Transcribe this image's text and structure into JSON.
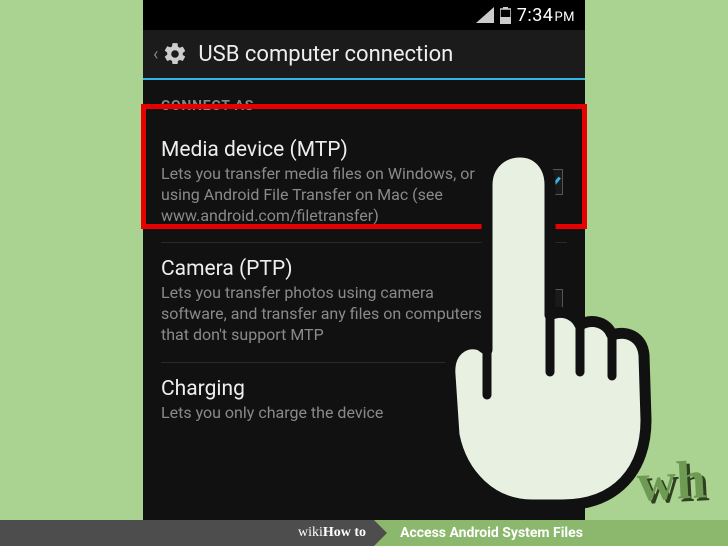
{
  "status": {
    "time": "7:34",
    "ampm": "PM"
  },
  "header": {
    "title": "USB computer connection"
  },
  "section_label": "CONNECT AS",
  "items": [
    {
      "title": "Media device (MTP)",
      "subtitle": "Lets you transfer media files on Windows, or using Android File Transfer on Mac (see www.android.com/filetransfer)",
      "checked": true
    },
    {
      "title": "Camera (PTP)",
      "subtitle": "Lets you transfer photos using camera software, and transfer any files on computers that don't support MTP",
      "checked": false
    },
    {
      "title": "Charging",
      "subtitle": "Lets you only charge the device",
      "checked": false
    }
  ],
  "footer": {
    "logo_a": "wiki",
    "logo_b": "How to",
    "prefix": "",
    "title": "Access Android System Files"
  },
  "watermark": "wH"
}
